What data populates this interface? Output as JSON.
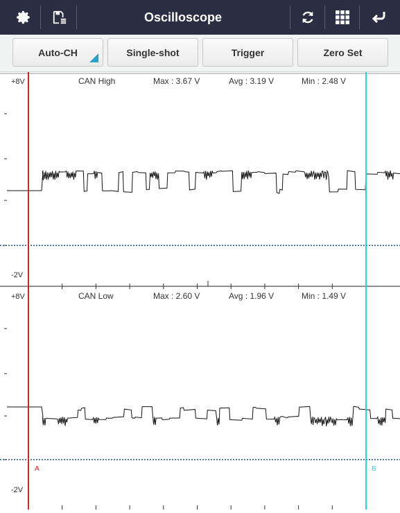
{
  "app": {
    "title": "Oscilloscope"
  },
  "toolbar": {
    "icons": [
      "gear-icon",
      "save-list-icon",
      "refresh-icon",
      "grid-icon",
      "back-arrow-icon"
    ]
  },
  "buttons": {
    "auto_ch": "Auto-CH",
    "single_shot": "Single-shot",
    "trigger": "Trigger",
    "zero_set": "Zero Set"
  },
  "channels": [
    {
      "name": "CAN High",
      "max": "Max : 3.67 V",
      "avg": "Avg : 3.19 V",
      "min": "Min : 2.48 V",
      "top_label": "+8V",
      "bottom_label": "-2V"
    },
    {
      "name": "CAN Low",
      "max": "Max : 2.60 V",
      "avg": "Avg : 1.96 V",
      "min": "Min : 1.49 V",
      "top_label": "+8V",
      "bottom_label": "-2V"
    }
  ],
  "cursors": {
    "a_label": "A",
    "b_label": "B"
  },
  "colors": {
    "header_bg": "#2b2e42",
    "cursor_a": "#e02020",
    "cursor_b": "#27d3e0",
    "zero_line": "#1f4f8a",
    "accent": "#2ba3c8"
  }
}
